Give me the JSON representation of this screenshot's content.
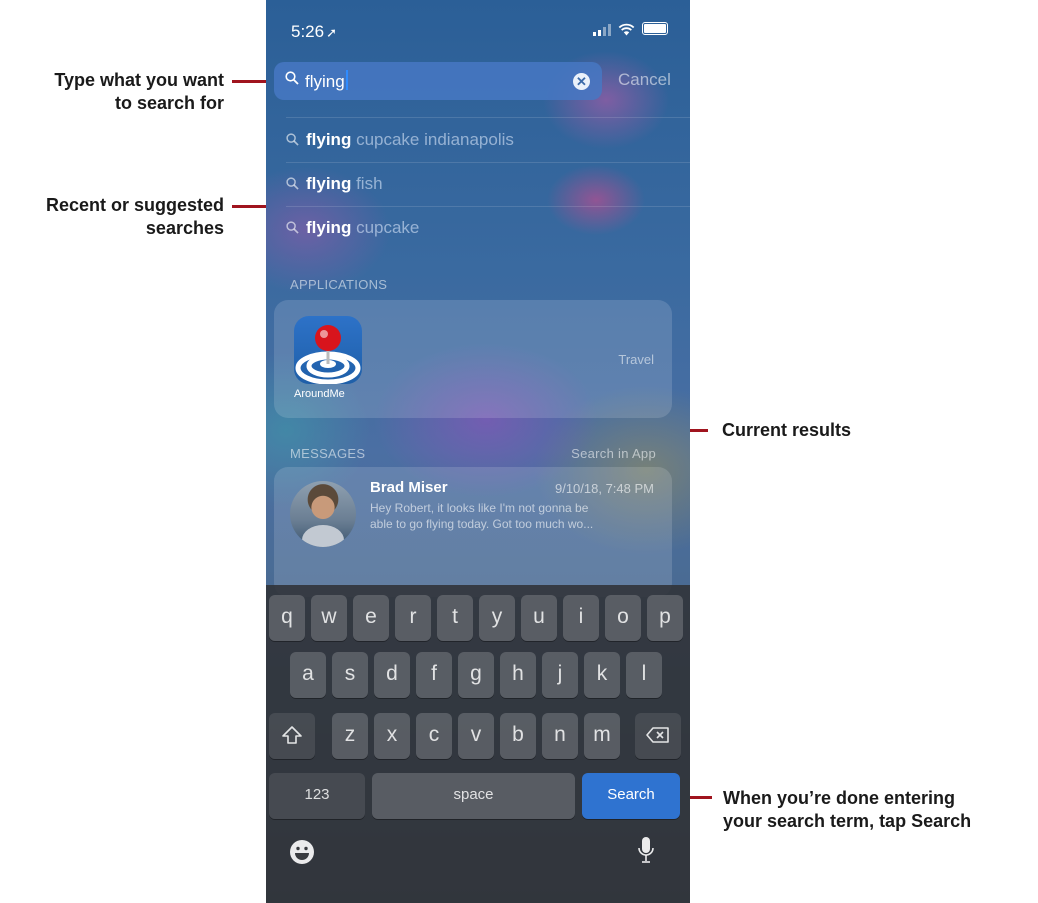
{
  "callouts": {
    "type_search": [
      "Type what you want",
      "to search for"
    ],
    "recent": [
      "Recent or suggested",
      "searches"
    ],
    "current": "Current results",
    "done": [
      "When you’re done entering",
      "your search term, tap Search"
    ]
  },
  "status": {
    "time": "5:26",
    "location_icon": "location-arrow-icon"
  },
  "search": {
    "query": "flying",
    "cancel_label": "Cancel"
  },
  "suggestions": [
    {
      "bold": "flying",
      "rest": " cupcake indianapolis"
    },
    {
      "bold": "flying",
      "rest": " fish"
    },
    {
      "bold": "flying",
      "rest": " cupcake"
    }
  ],
  "applications": {
    "header": "APPLICATIONS",
    "app_name": "AroundMe",
    "category": "Travel"
  },
  "messages": {
    "header": "MESSAGES",
    "search_in_app": "Search in App",
    "sender": "Brad Miser",
    "date": "9/10/18, 7:48 PM",
    "preview_line1": "Hey Robert, it looks like I'm not gonna be",
    "preview_line2": "able to go flying today. Got too much wo..."
  },
  "keyboard": {
    "row1": [
      "q",
      "w",
      "e",
      "r",
      "t",
      "y",
      "u",
      "i",
      "o",
      "p"
    ],
    "row2": [
      "a",
      "s",
      "d",
      "f",
      "g",
      "h",
      "j",
      "k",
      "l"
    ],
    "row3": [
      "z",
      "x",
      "c",
      "v",
      "b",
      "n",
      "m"
    ],
    "numbers_label": "123",
    "space_label": "space",
    "search_label": "Search"
  },
  "colors": {
    "callout_line": "#a0141e",
    "search_key": "#2f73d0"
  }
}
